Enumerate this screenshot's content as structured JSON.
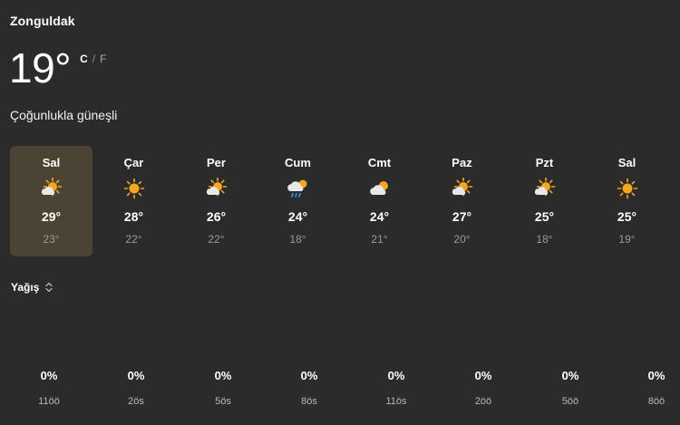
{
  "location": "Zonguldak",
  "current": {
    "temp": "19°",
    "unit_c": "C",
    "unit_sep": "/",
    "unit_f": "F",
    "condition": "Çoğunlukla güneşli"
  },
  "forecast": [
    {
      "day": "Sal",
      "icon": "partly-sunny-icon",
      "high": "29°",
      "low": "23°",
      "selected": true
    },
    {
      "day": "Çar",
      "icon": "sunny-icon",
      "high": "28°",
      "low": "22°",
      "selected": false
    },
    {
      "day": "Per",
      "icon": "partly-sunny-icon",
      "high": "26°",
      "low": "22°",
      "selected": false
    },
    {
      "day": "Cum",
      "icon": "rain-showers-icon",
      "high": "24°",
      "low": "18°",
      "selected": false
    },
    {
      "day": "Cmt",
      "icon": "mostly-cloudy-icon",
      "high": "24°",
      "low": "21°",
      "selected": false
    },
    {
      "day": "Paz",
      "icon": "partly-sunny-icon",
      "high": "27°",
      "low": "20°",
      "selected": false
    },
    {
      "day": "Pzt",
      "icon": "partly-sunny-icon",
      "high": "25°",
      "low": "18°",
      "selected": false
    },
    {
      "day": "Sal",
      "icon": "sunny-icon",
      "high": "25°",
      "low": "19°",
      "selected": false
    }
  ],
  "precipitation": {
    "label": "Yağış",
    "hours": [
      {
        "pct": "0%",
        "time": "11öö"
      },
      {
        "pct": "0%",
        "time": "2ös"
      },
      {
        "pct": "0%",
        "time": "5ös"
      },
      {
        "pct": "0%",
        "time": "8ös"
      },
      {
        "pct": "0%",
        "time": "11ös"
      },
      {
        "pct": "0%",
        "time": "2öö"
      },
      {
        "pct": "0%",
        "time": "5öö"
      },
      {
        "pct": "0%",
        "time": "8öö"
      }
    ]
  },
  "colors": {
    "background": "#2b2b2b",
    "selected_day": "#4b4334",
    "sun": "#f5a623",
    "cloud": "#e8e8e8",
    "rain": "#4aa3f0",
    "muted_text": "#9a9a9a"
  }
}
